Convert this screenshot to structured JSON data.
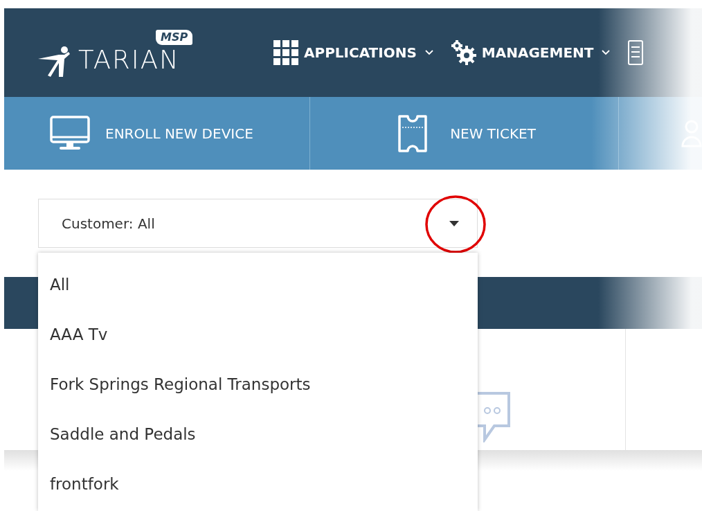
{
  "logo": {
    "text": "TARIAN",
    "badge": "MSP"
  },
  "nav": [
    {
      "label": "APPLICATIONS",
      "kind": "grid"
    },
    {
      "label": "MANAGEMENT",
      "kind": "gears"
    },
    {
      "kind": "report"
    }
  ],
  "quick_actions": [
    {
      "label": "ENROLL NEW DEVICE",
      "kind": "monitor"
    },
    {
      "label": "NEW TICKET",
      "kind": "ticket"
    },
    {
      "kind": "person"
    }
  ],
  "customer_filter": {
    "value": "Customer: All",
    "caret_highlighted": true,
    "expanded": true,
    "options": [
      {
        "label": "All"
      },
      {
        "label": "AAA Tv"
      },
      {
        "label": "Fork Springs Regional Transports"
      },
      {
        "label": "Saddle and Pedals"
      },
      {
        "label": "frontfork"
      }
    ]
  }
}
